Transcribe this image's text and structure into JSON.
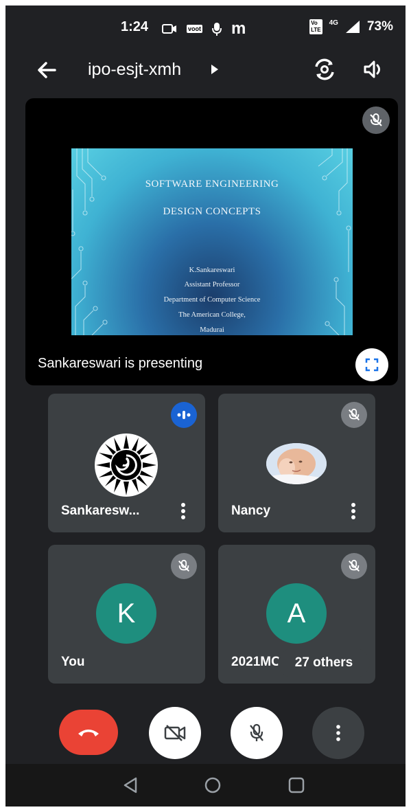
{
  "status_bar": {
    "time": "1:24",
    "app_icon_label": "voot",
    "m_icon_label": "m",
    "volte_label": "Vo\nLTE",
    "network_label": "4G",
    "battery": "73%"
  },
  "header": {
    "meeting_code": "ipo-esjt-xmh"
  },
  "presentation": {
    "slide": {
      "title_line1": "SOFTWARE ENGINEERING",
      "title_line2": "DESIGN CONCEPTS",
      "author": "K.Sankareswari",
      "role": "Assistant Professor",
      "department": "Department of Computer Science",
      "college": "The American College,",
      "city": "Madurai"
    },
    "caption": "Sankareswari is presenting"
  },
  "participants": [
    {
      "name": "Sankaresw...",
      "state": "speaking"
    },
    {
      "name": "Nancy",
      "state": "muted"
    },
    {
      "name": "You",
      "initial": "K",
      "state": "muted"
    },
    {
      "name": "2021MC...",
      "initial": "A",
      "state": "muted"
    }
  ],
  "others_label": "27 others",
  "colors": {
    "background": "#202124",
    "tile": "#3c4043",
    "end_call": "#ea4335",
    "speaking": "#1a63d3",
    "avatar": "#1e8e7e"
  }
}
